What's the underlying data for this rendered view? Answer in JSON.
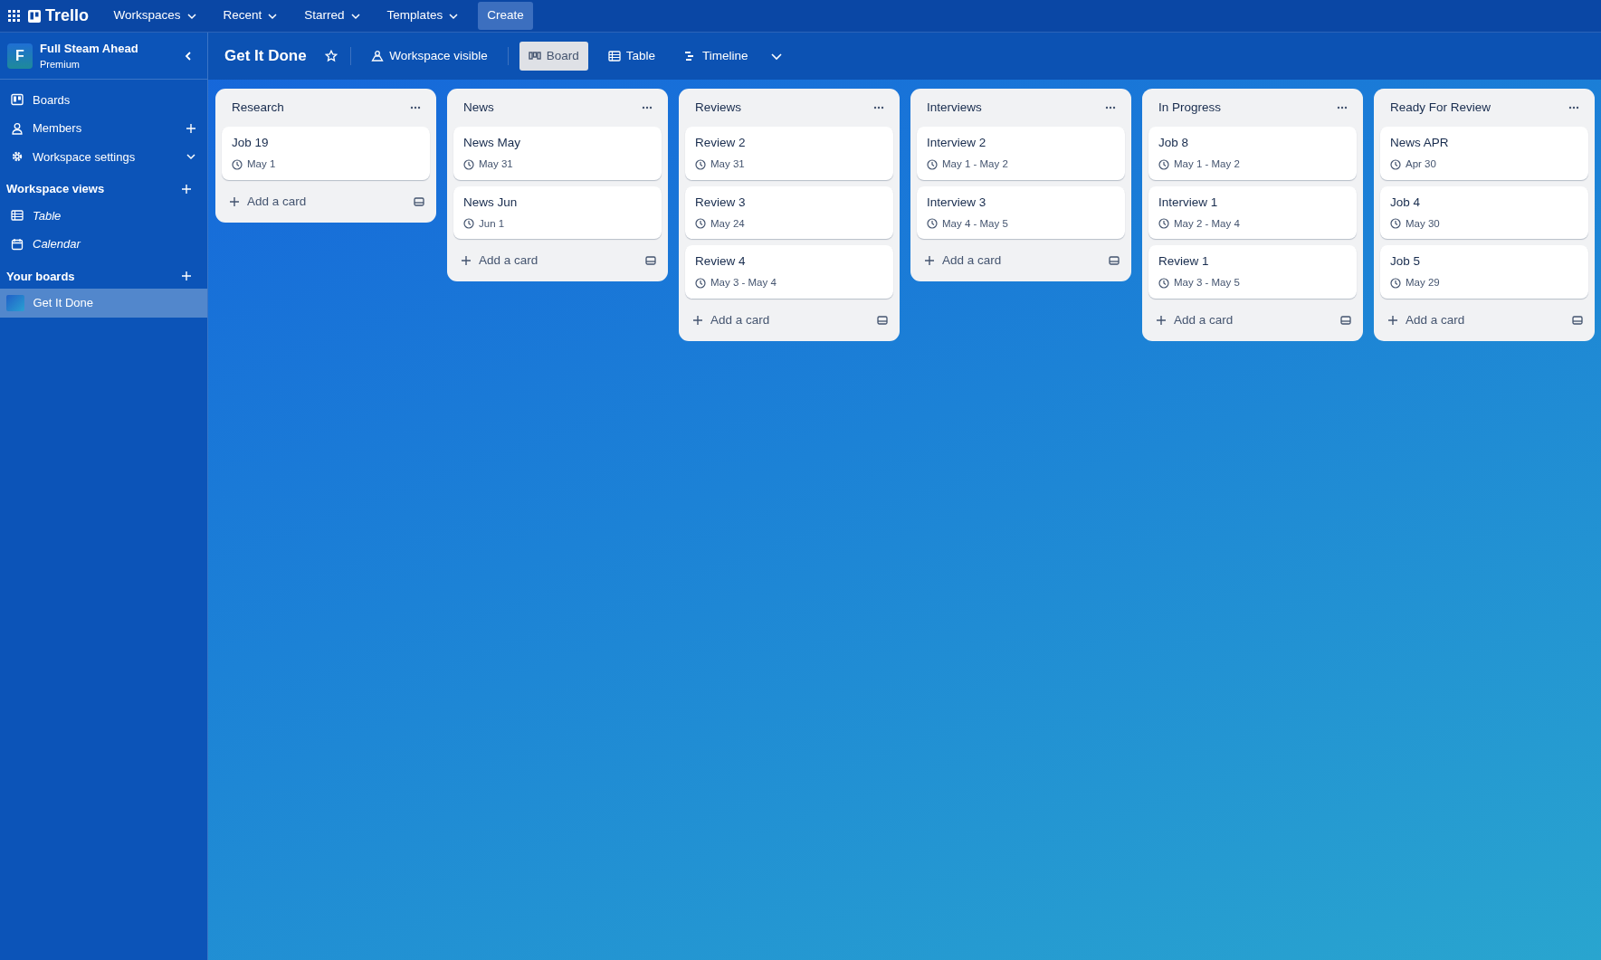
{
  "topbar": {
    "logo": "Trello",
    "menus": [
      {
        "label": "Workspaces"
      },
      {
        "label": "Recent"
      },
      {
        "label": "Starred"
      },
      {
        "label": "Templates"
      }
    ],
    "create": "Create"
  },
  "sidebar": {
    "workspace": {
      "initial": "F",
      "name": "Full Steam Ahead",
      "plan": "Premium"
    },
    "items": [
      {
        "label": "Boards",
        "kind": "plain"
      },
      {
        "label": "Members",
        "kind": "addable"
      },
      {
        "label": "Workspace settings",
        "kind": "expandable"
      }
    ],
    "views_heading": "Workspace views",
    "views": [
      {
        "label": "Table"
      },
      {
        "label": "Calendar"
      }
    ],
    "boards_heading": "Your boards",
    "boards": [
      {
        "label": "Get It Done",
        "selected": true
      }
    ]
  },
  "board": {
    "title": "Get It Done",
    "visibility": "Workspace visible",
    "views": [
      {
        "label": "Board",
        "selected": true
      },
      {
        "label": "Table",
        "selected": false
      },
      {
        "label": "Timeline",
        "selected": false
      }
    ],
    "lists": [
      {
        "title": "Research",
        "cards": [
          {
            "title": "Job 19",
            "due": "May 1"
          }
        ],
        "add": "Add a card"
      },
      {
        "title": "News",
        "cards": [
          {
            "title": "News May",
            "due": "May 31"
          },
          {
            "title": "News Jun",
            "due": "Jun 1"
          }
        ],
        "add": "Add a card"
      },
      {
        "title": "Reviews",
        "cards": [
          {
            "title": "Review 2",
            "due": "May 31"
          },
          {
            "title": "Review 3",
            "due": "May 24"
          },
          {
            "title": "Review 4",
            "due": "May 3 - May 4"
          }
        ],
        "add": "Add a card"
      },
      {
        "title": "Interviews",
        "cards": [
          {
            "title": "Interview 2",
            "due": "May 1 - May 2"
          },
          {
            "title": "Interview 3",
            "due": "May 4 - May 5"
          }
        ],
        "add": "Add a card"
      },
      {
        "title": "In Progress",
        "cards": [
          {
            "title": "Job 8",
            "due": "May 1 - May 2"
          },
          {
            "title": "Interview 1",
            "due": "May 2 - May 4"
          },
          {
            "title": "Review 1",
            "due": "May 3 - May 5"
          }
        ],
        "add": "Add a card"
      },
      {
        "title": "Ready For Review",
        "cards": [
          {
            "title": "News APR",
            "due": "Apr 30"
          },
          {
            "title": "Job 4",
            "due": "May 30"
          },
          {
            "title": "Job 5",
            "due": "May 29"
          }
        ],
        "add": "Add a card"
      }
    ]
  }
}
